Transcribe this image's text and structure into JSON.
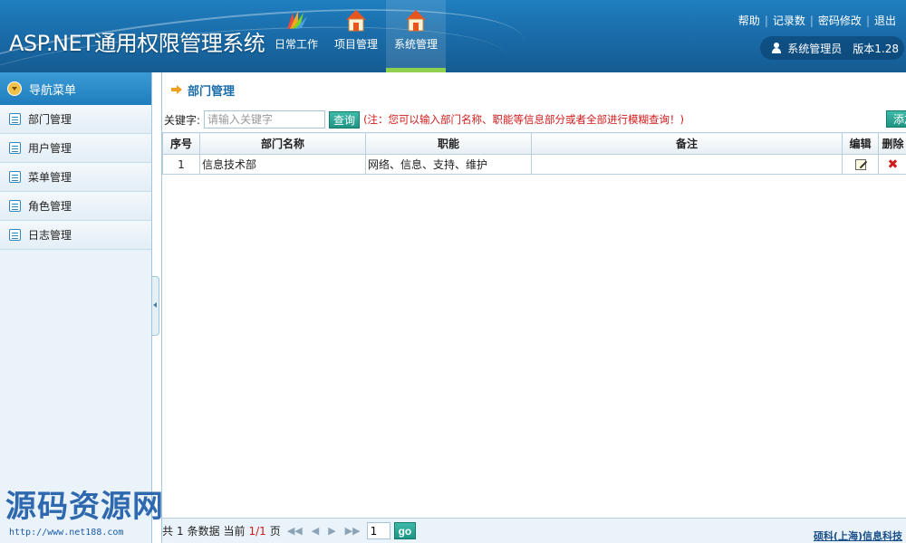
{
  "header": {
    "app_title": "ASP.NET通用权限管理系统",
    "nav": [
      {
        "label": "日常工作",
        "icon": "color-fan-icon"
      },
      {
        "label": "项目管理",
        "icon": "house-icon"
      },
      {
        "label": "系统管理",
        "icon": "house-icon",
        "active": true
      }
    ],
    "links": [
      "帮助",
      "记录数",
      "密码修改",
      "退出"
    ],
    "user": "系统管理员",
    "version": "版本1.28"
  },
  "sidebar": {
    "title": "导航菜单",
    "items": [
      {
        "label": "部门管理"
      },
      {
        "label": "用户管理"
      },
      {
        "label": "菜单管理"
      },
      {
        "label": "角色管理"
      },
      {
        "label": "日志管理"
      }
    ]
  },
  "main": {
    "breadcrumb": "部门管理",
    "search": {
      "label": "关键字:",
      "placeholder": "请输入关键字",
      "button": "查询",
      "note": "(注：您可以输入部门名称、职能等信息部分或者全部进行模糊查询！)",
      "add_button": "添加"
    },
    "table": {
      "columns": [
        "序号",
        "部门名称",
        "职能",
        "备注",
        "编辑",
        "删除"
      ],
      "rows": [
        {
          "index": "1",
          "name": "信息技术部",
          "function": "网络、信息、支持、维护",
          "remark": ""
        }
      ]
    },
    "pager": {
      "prefix": "共",
      "total": "1",
      "mid": "条数据 当前",
      "current": "1/1",
      "suffix": "页",
      "page_value": "1",
      "go": "go"
    },
    "company": "硕科(上海)信息科技"
  },
  "watermark": {
    "text": "源码资源网",
    "url": "http://www.net188.com"
  },
  "colors": {
    "header_blue": "#1a6daa",
    "accent_green": "#8fd14f",
    "button_teal": "#1e9585",
    "note_red": "#d11a1a"
  }
}
